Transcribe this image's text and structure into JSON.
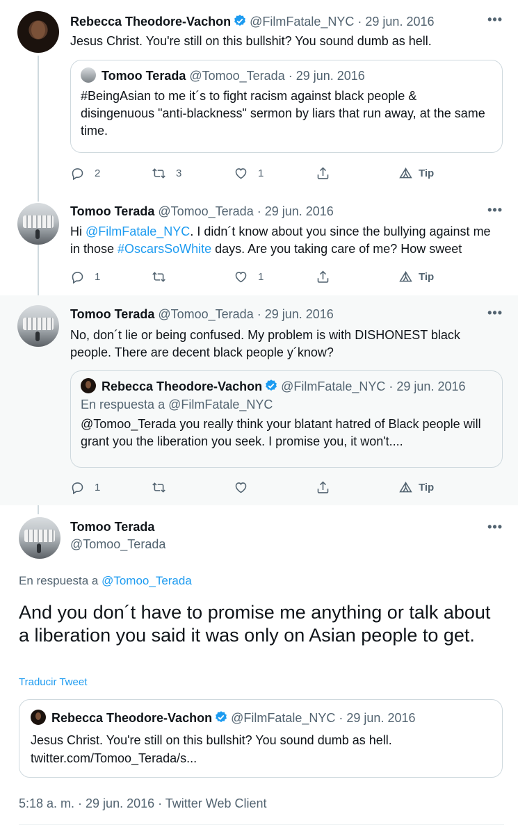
{
  "tweet1": {
    "name": "Rebecca Theodore-Vachon",
    "handle": "@FilmFatale_NYC",
    "date": "· 29 jun. 2016",
    "text": "Jesus Christ. You're still on this bullshit? You sound dumb as hell.",
    "quote": {
      "name": "Tomoo Terada",
      "handle": "@Tomoo_Terada",
      "date": "· 29 jun. 2016",
      "text": "#BeingAsian to me it´s to fight racism against black people & disingenuous \"anti-blackness\" sermon by liars that run away, at the same time."
    },
    "replies": "2",
    "retweets": "3",
    "likes": "1",
    "tip": "Tip"
  },
  "tweet2": {
    "name": "Tomoo Terada",
    "handle": "@Tomoo_Terada",
    "date": "· 29 jun. 2016",
    "text_before": "Hi ",
    "mention": "@FilmFatale_NYC",
    "text_mid": ". I didn´t know about you since the bullying against me in those ",
    "hashtag": "#OscarsSoWhite",
    "text_after": " days. Are you taking care of me? How sweet",
    "replies": "1",
    "retweets": "",
    "likes": "1",
    "tip": "Tip"
  },
  "tweet3": {
    "name": "Tomoo Terada",
    "handle": "@Tomoo_Terada",
    "date": "· 29 jun. 2016",
    "text": "No, don´t lie or being confused. My problem is with DISHONEST black people. There are decent black people y´know?",
    "quote": {
      "name": "Rebecca Theodore-Vachon",
      "handle": "@FilmFatale_NYC",
      "date": "· 29 jun. 2016",
      "reply_to": "En respuesta a @FilmFatale_NYC",
      "text": "@Tomoo_Terada you really think your blatant hatred of Black people will grant you the liberation you seek. I promise you, it won't...."
    },
    "replies": "1",
    "retweets": "",
    "likes": "",
    "tip": "Tip"
  },
  "main": {
    "name": "Tomoo Terada",
    "handle": "@Tomoo_Terada",
    "reply_prefix": "En respuesta a ",
    "reply_handle": "@Tomoo_Terada",
    "text": "And you don´t have to promise me anything or talk about a liberation you said it was only on Asian people to get.",
    "translate": "Traducir Tweet",
    "quote": {
      "name": "Rebecca Theodore-Vachon",
      "handle": "@FilmFatale_NYC",
      "date": "· 29 jun. 2016",
      "text": "Jesus Christ. You're still on this bullshit? You sound dumb as hell.",
      "link": "twitter.com/Tomoo_Terada/s..."
    },
    "meta": "5:18 a. m. · 29 jun. 2016 · Twitter Web Client"
  },
  "more_glyph": "•••",
  "colors": {
    "link": "#1d9bf0",
    "muted": "#536471",
    "verified": "#1d9bf0",
    "highlight_bg": "#f7f9f9"
  }
}
